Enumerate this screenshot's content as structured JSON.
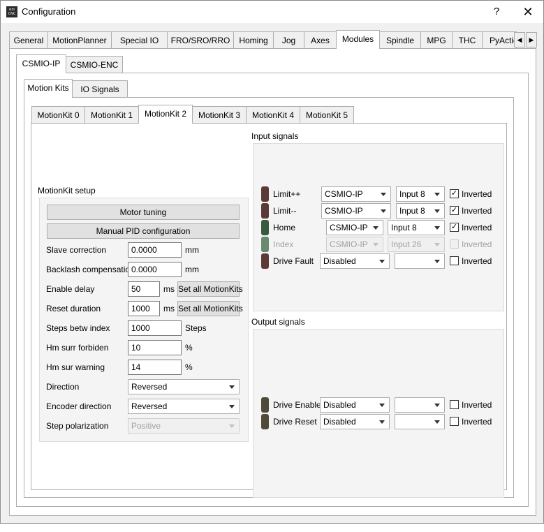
{
  "window": {
    "title": "Configuration",
    "app_icon_text": "sim\nCNC",
    "help_label": "?",
    "close_label": "✕"
  },
  "main_tabs": [
    "General",
    "MotionPlanner",
    "Special IO",
    "FRO/SRO/RRO",
    "Homing",
    "Jog",
    "Axes",
    "Modules",
    "Spindle",
    "MPG",
    "THC",
    "PyActio"
  ],
  "module_tabs": [
    "CSMIO-IP",
    "CSMIO-ENC"
  ],
  "sub_tabs": [
    "Motion Kits",
    "IO Signals"
  ],
  "kit_tabs": [
    "MotionKit 0",
    "MotionKit 1",
    "MotionKit 2",
    "MotionKit 3",
    "MotionKit 4",
    "MotionKit 5"
  ],
  "setup": {
    "group_title": "MotionKit setup",
    "motor_tuning": "Motor tuning",
    "manual_pid": "Manual PID configuration",
    "slave_correction": {
      "label": "Slave correction",
      "value": "0.0000",
      "unit": "mm"
    },
    "backlash": {
      "label": "Backlash compensation",
      "value": "0.0000",
      "unit": "mm"
    },
    "enable_delay": {
      "label": "Enable delay",
      "value": "50",
      "unit": "ms",
      "button": "Set all MotionKits"
    },
    "reset_duration": {
      "label": "Reset duration",
      "value": "1000",
      "unit": "ms",
      "button": "Set all MotionKits"
    },
    "steps_betw_index": {
      "label": "Steps betw index",
      "value": "1000",
      "unit": "Steps"
    },
    "hm_surr_forbiden": {
      "label": "Hm surr forbiden",
      "value": "10",
      "unit": "%"
    },
    "hm_sur_warning": {
      "label": "Hm sur warning",
      "value": "14",
      "unit": "%"
    },
    "direction": {
      "label": "Direction",
      "value": "Reversed"
    },
    "encoder_direction": {
      "label": "Encoder direction",
      "value": "Reversed"
    },
    "step_polarization": {
      "label": "Step polarization",
      "value": "Positive"
    }
  },
  "input_signals": {
    "title": "Input signals",
    "rows": [
      {
        "name": "Limit++",
        "source": "CSMIO-IP",
        "pin": "Input 8",
        "inverted": true,
        "inverted_label": "Inverted",
        "led_color": "#5c3a36"
      },
      {
        "name": "Limit--",
        "source": "CSMIO-IP",
        "pin": "Input 8",
        "inverted": true,
        "inverted_label": "Inverted",
        "led_color": "#5c3a36"
      },
      {
        "name": "Home",
        "source": "CSMIO-IP",
        "pin": "Input 8",
        "inverted": true,
        "inverted_label": "Inverted",
        "led_color": "#3a5a40"
      },
      {
        "name": "Index",
        "source": "CSMIO-IP",
        "pin": "Input 26",
        "inverted": false,
        "inverted_label": "Inverted",
        "led_color": "#6a8a70"
      },
      {
        "name": "Drive Fault",
        "source": "Disabled",
        "pin": "",
        "inverted": false,
        "inverted_label": "Inverted",
        "led_color": "#5c3a36"
      }
    ]
  },
  "output_signals": {
    "title": "Output signals",
    "rows": [
      {
        "name": "Drive Enable",
        "source": "Disabled",
        "pin": "",
        "inverted": false,
        "inverted_label": "Inverted",
        "led_color": "#4f4a3a"
      },
      {
        "name": "Drive Reset",
        "source": "Disabled",
        "pin": "",
        "inverted": false,
        "inverted_label": "Inverted",
        "led_color": "#4f4a3a"
      }
    ]
  }
}
